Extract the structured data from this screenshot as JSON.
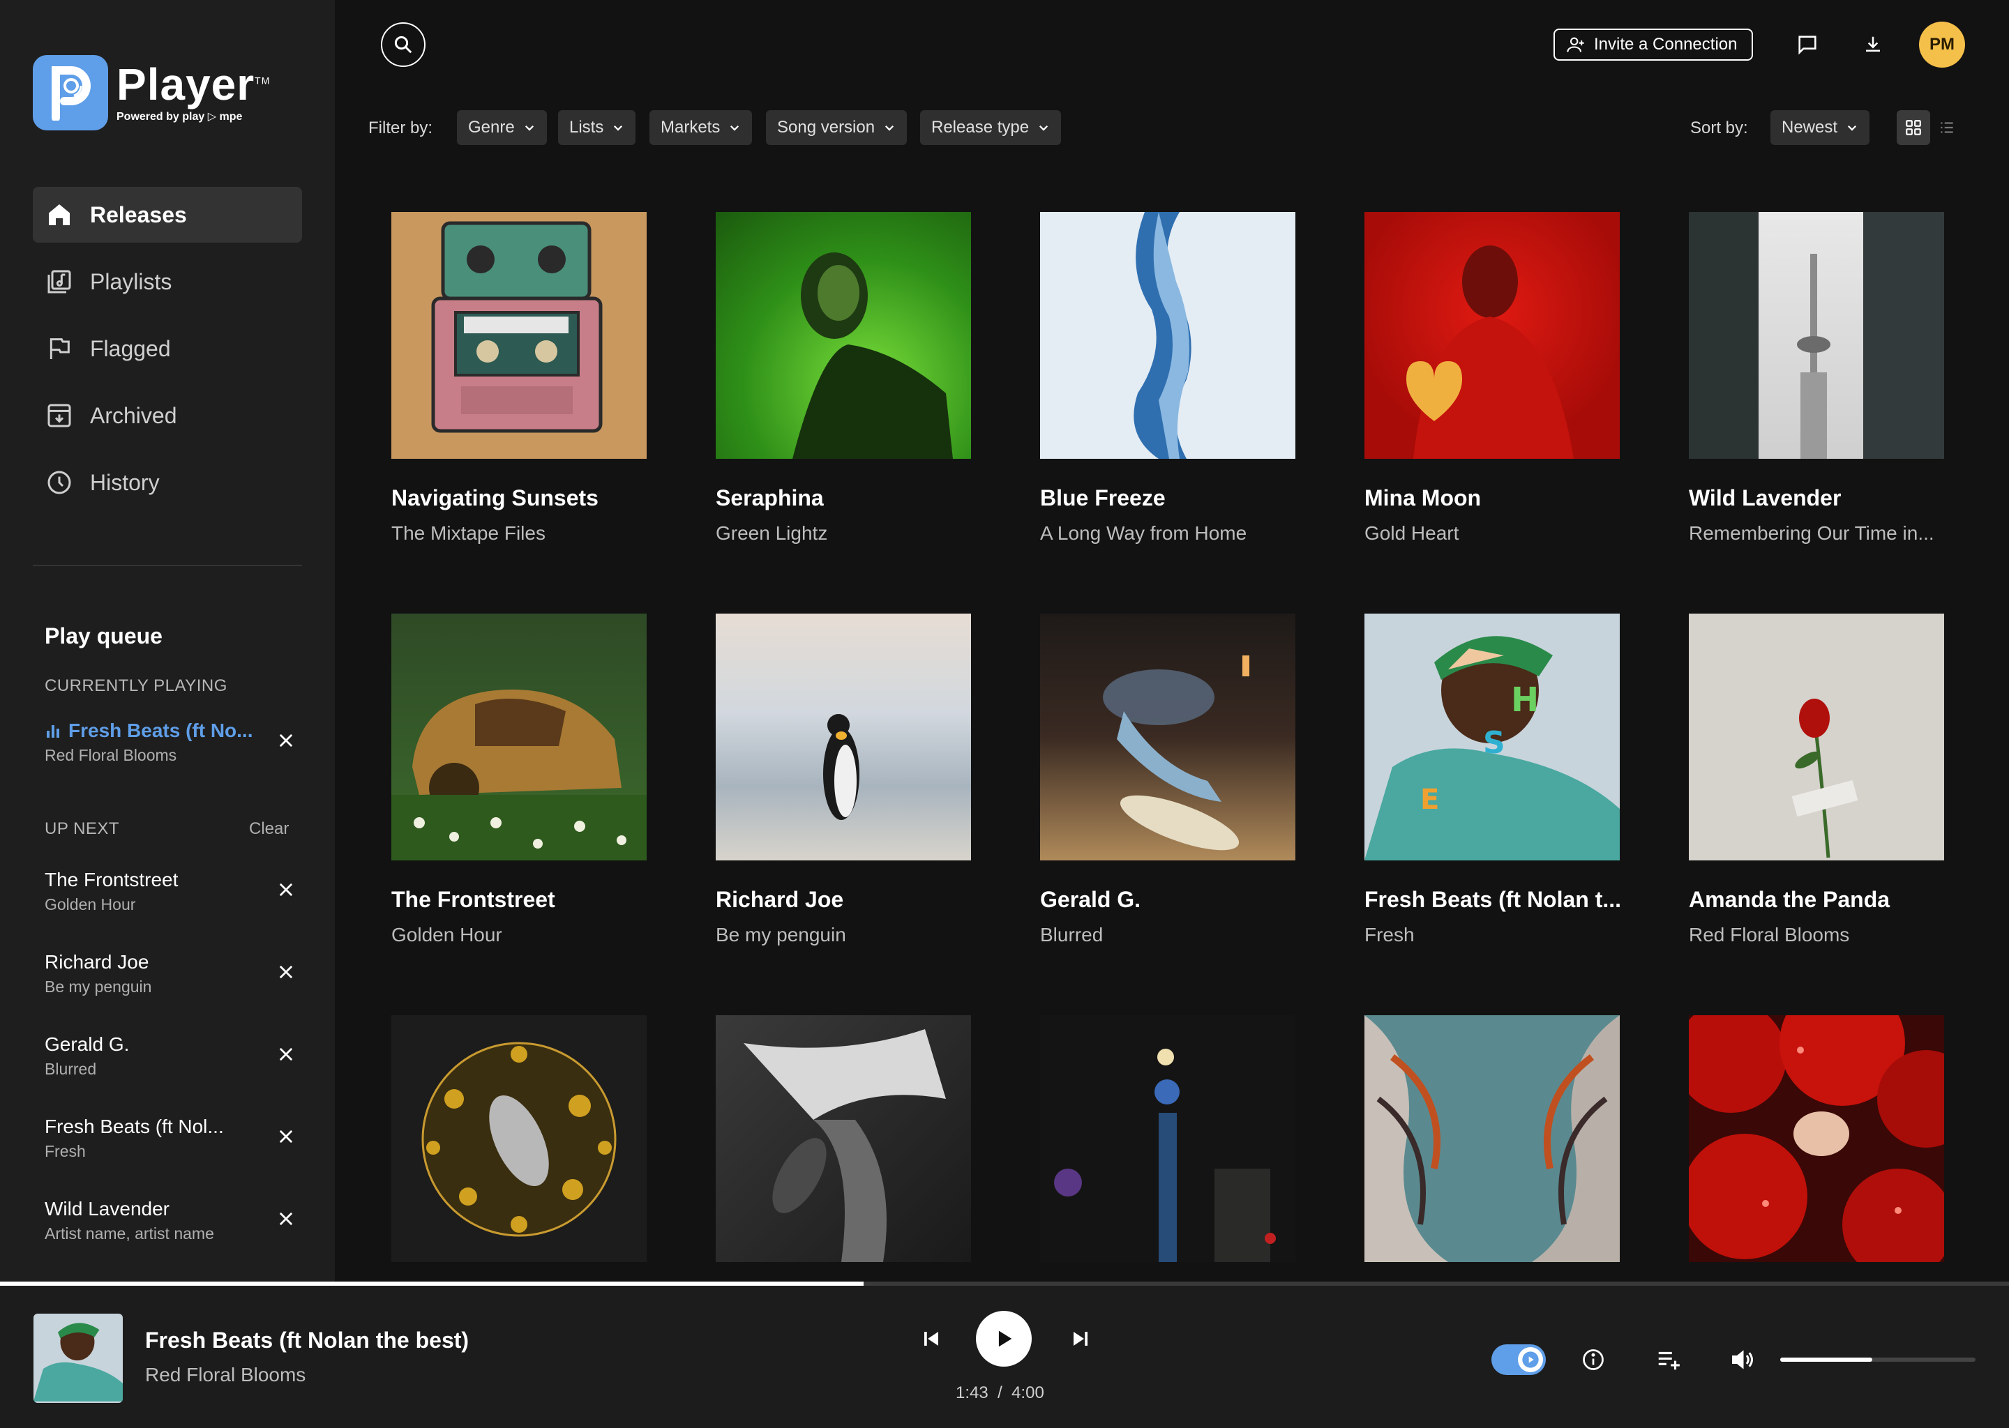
{
  "brand": {
    "name": "Player",
    "tm": "TM",
    "powered_by": "Powered by play ▷ mpe"
  },
  "nav": {
    "items": [
      {
        "label": "Releases",
        "icon": "home-icon",
        "active": true
      },
      {
        "label": "Playlists",
        "icon": "playlists-icon",
        "active": false
      },
      {
        "label": "Flagged",
        "icon": "flag-icon",
        "active": false
      },
      {
        "label": "Archived",
        "icon": "archive-icon",
        "active": false
      },
      {
        "label": "History",
        "icon": "history-icon",
        "active": false
      }
    ]
  },
  "queue": {
    "title": "Play queue",
    "currently_playing_label": "CURRENTLY PLAYING",
    "current": {
      "title": "Fresh Beats (ft No...",
      "artist": "Red Floral Blooms"
    },
    "up_next_label": "UP NEXT",
    "clear_label": "Clear",
    "items": [
      {
        "title": "The Frontstreet",
        "artist": "Golden Hour"
      },
      {
        "title": "Richard Joe",
        "artist": "Be my penguin"
      },
      {
        "title": "Gerald G.",
        "artist": "Blurred"
      },
      {
        "title": "Fresh Beats (ft Nol...",
        "artist": "Fresh"
      },
      {
        "title": "Wild Lavender",
        "artist": "Artist name, artist name"
      }
    ]
  },
  "header": {
    "invite_label": "Invite a Connection",
    "avatar_initials": "PM"
  },
  "filters": {
    "label": "Filter by:",
    "chips": [
      "Genre",
      "Lists",
      "Markets",
      "Song version",
      "Release type"
    ],
    "sort_label": "Sort by:",
    "sort_value": "Newest"
  },
  "releases": [
    {
      "title": "Navigating Sunsets",
      "artist": "The Mixtape Files",
      "art": "cassette"
    },
    {
      "title": "Seraphina",
      "artist": "Green Lightz",
      "art": "green"
    },
    {
      "title": "Blue Freeze",
      "artist": "A Long Way from Home",
      "art": "ice"
    },
    {
      "title": "Mina Moon",
      "artist": "Gold Heart",
      "art": "red"
    },
    {
      "title": "Wild Lavender",
      "artist": "Remembering Our Time in...",
      "art": "tower"
    },
    {
      "title": "The Frontstreet",
      "artist": "Golden Hour",
      "art": "car"
    },
    {
      "title": "Richard Joe",
      "artist": "Be my penguin",
      "art": "penguin"
    },
    {
      "title": "Gerald G.",
      "artist": "Blurred",
      "art": "skate"
    },
    {
      "title": "Fresh Beats (ft Nolan t...",
      "artist": "Fresh",
      "art": "fresh"
    },
    {
      "title": "Amanda the Panda",
      "artist": "Red Floral Blooms",
      "art": "rose"
    },
    {
      "title": "",
      "artist": "",
      "art": "sphere"
    },
    {
      "title": "",
      "artist": "",
      "art": "mono"
    },
    {
      "title": "",
      "artist": "",
      "art": "night"
    },
    {
      "title": "",
      "artist": "",
      "art": "swirl"
    },
    {
      "title": "",
      "artist": "",
      "art": "balloons"
    }
  ],
  "player": {
    "title": "Fresh Beats (ft Nolan the best)",
    "artist": "Red Floral Blooms",
    "elapsed": "1:43",
    "separator": "/",
    "duration": "4:00",
    "progress": 0.43,
    "volume": 0.47
  },
  "colors": {
    "accent": "#5f9ee8",
    "avatar": "#f5c04a",
    "bg": "#121212",
    "sidebar": "#1e1e1e"
  }
}
